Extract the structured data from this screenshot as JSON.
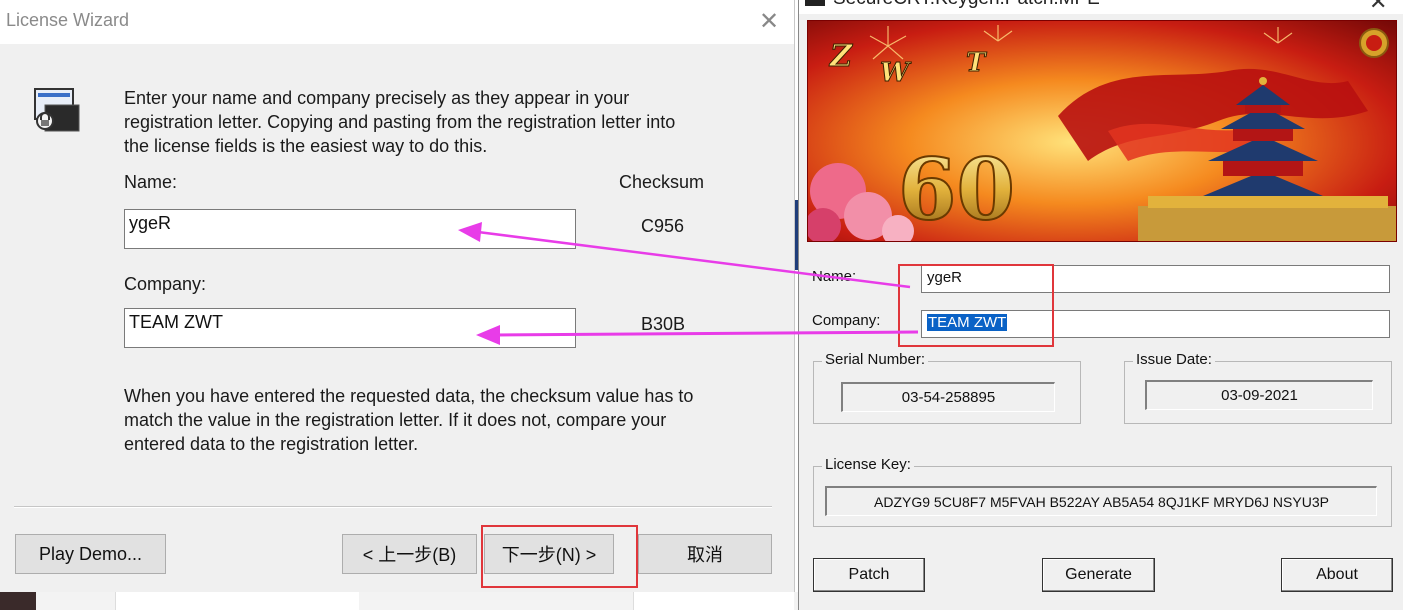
{
  "wizard": {
    "title": "License Wizard",
    "close": "✕",
    "intro": "Enter your name and company precisely as they appear in your\nregistration letter.  Copying and pasting from the registration letter into\nthe license fields is the easiest way to do this.",
    "name_label": "Name:",
    "checksum_label": "Checksum",
    "name_value": "ygeR",
    "name_checksum": "C956",
    "company_label": "Company:",
    "company_value": "TEAM ZWT",
    "company_checksum": "B30B",
    "outro": "When you have entered the requested data, the checksum value has to\nmatch the value in the registration letter.  If it does not, compare your\nentered data to the registration letter.",
    "buttons": {
      "play_demo": "Play Demo...",
      "back": "< 上一步(B)",
      "next": "下一步(N) >",
      "cancel": "取消"
    }
  },
  "keygen": {
    "title": "SecureCRT.Keygen.Patch.MPE",
    "close": "✕",
    "banner": {
      "letters": [
        "Z",
        "W",
        "T"
      ],
      "number": "60"
    },
    "name_label": "Name:",
    "name_value": "ygeR",
    "company_label": "Company:",
    "company_value": "TEAM ZWT",
    "serial_label": "Serial Number:",
    "serial_value": "03-54-258895",
    "issue_label": "Issue Date:",
    "issue_value": "03-09-2021",
    "license_label": "License Key:",
    "license_value": "ADZYG9 5CU8F7 M5FVAH B522AY AB5A54 8QJ1KF MRYD6J NSYU3P",
    "buttons": {
      "patch": "Patch",
      "generate": "Generate",
      "about": "About"
    }
  },
  "colors": {
    "highlight_box": "#e0363b",
    "arrow": "#e83ce8",
    "selection": "#0a62c6"
  }
}
